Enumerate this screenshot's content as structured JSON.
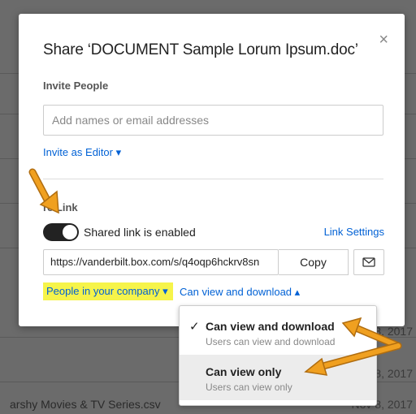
{
  "background": {
    "bottom_file_name": "arshy Movies & TV Series.csv",
    "dates": [
      "8, 2017",
      "8, 2017",
      "Nov 8, 2017"
    ]
  },
  "dialog": {
    "title": "Share ‘DOCUMENT Sample Lorum Ipsum.doc’",
    "close_icon": "×",
    "invite_heading": "Invite People",
    "invite_placeholder": "Add names or email addresses",
    "invite_role": "Invite as Editor ▾",
    "share_link_heading": "re Link",
    "toggle_label": "Shared link is enabled",
    "link_settings": "Link Settings",
    "url": "https://vanderbilt.box.com/s/q4oqp6hckrv8sn",
    "copy_label": "Copy",
    "access_level": "People in your company ▾",
    "permission": "Can view and download ▴"
  },
  "permission_menu": {
    "options": [
      {
        "label": "Can view and download",
        "description": "Users can view and download",
        "selected": true
      },
      {
        "label": "Can view only",
        "description": "Users can view only",
        "selected": false
      }
    ]
  },
  "annotation_colors": {
    "arrow": "#f0a020",
    "highlight": "#f6f44a"
  }
}
